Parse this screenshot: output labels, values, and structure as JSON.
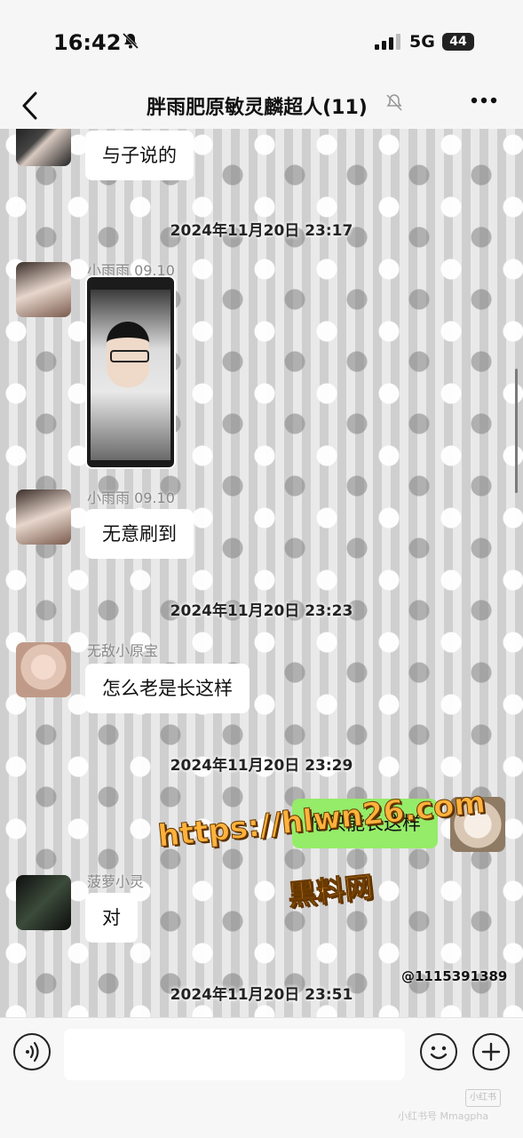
{
  "status_bar": {
    "time": "16:42",
    "network": "5G",
    "battery": "44",
    "icons": [
      "bell-slash-icon",
      "signal-icon"
    ]
  },
  "header": {
    "title": "胖雨肥原敏灵麟超人(11)",
    "icons": [
      "back-chevron-icon",
      "mute-bell-icon",
      "more-dots-icon"
    ]
  },
  "messages": {
    "first_bubble": "与子说的",
    "ts1": "2024年11月20日 23:17",
    "sender1": "小雨雨 09.10",
    "sender2": "小雨雨 09.10",
    "bubble2": "无意刷到",
    "ts2": "2024年11月20日 23:23",
    "sender3": "无敌小原宝",
    "bubble3": "怎么老是长这样",
    "ts3": "2024年11月20日 23:29",
    "my_bubble": "他只能长这样",
    "sender4": "菠萝小灵",
    "bubble4": "对",
    "ts4": "2024年11月20日 23:51"
  },
  "watermark": {
    "url": "https://hlwn26.com",
    "name": "黑料网",
    "id": "@1115391389"
  },
  "input_bar": {
    "placeholder": "",
    "badge": "小红书",
    "mark": "小红书号 Mmagpha"
  },
  "colors": {
    "my_bubble": "#95ec69",
    "other_bubble": "#ffffff",
    "watermark": "#ffb23c"
  }
}
